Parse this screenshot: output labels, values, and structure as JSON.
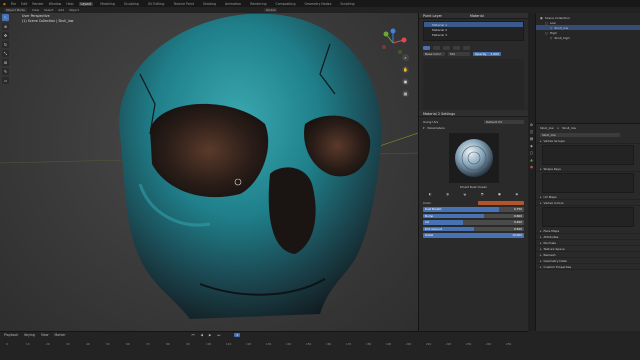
{
  "topbar": {
    "items": [
      "File",
      "Edit",
      "Render",
      "Window",
      "Help"
    ],
    "workspaces": [
      "Layout",
      "Modeling",
      "Sculpting",
      "UV Editing",
      "Texture Paint",
      "Shading",
      "Animation",
      "Rendering",
      "Compositing",
      "Geometry Nodes",
      "Scripting"
    ],
    "active_workspace": "Layout"
  },
  "toolstrip": {
    "mode": "Object Mode",
    "menus": [
      "View",
      "Select",
      "Add",
      "Object"
    ],
    "orientation": "Global"
  },
  "viewport": {
    "info_line1": "User Perspective",
    "info_line2": "(1) Scene Collection | Skull_low",
    "tools": [
      "cursor",
      "move",
      "rotate",
      "scale",
      "transform",
      "annotate",
      "measure"
    ]
  },
  "material_panel": {
    "header": "Point Layer",
    "header2": "Material",
    "slots": [
      "Material 1",
      "Material 2",
      "Material 3"
    ],
    "base_color_label": "Base Color",
    "blend_mode": "Mix",
    "opacity_label": "Opacity",
    "opacity_value": "1.000",
    "section_settings": "Material 2 Settings",
    "using_uvs_label": "Using UVs",
    "using_uvs_value": "Default UV",
    "parameters_label": "Parameters",
    "preset_name": "Smart Rust Ocean",
    "color_label": "Color",
    "params": [
      {
        "label": "Rust Breath",
        "value": "0.750",
        "fraction": 0.75
      },
      {
        "label": "Bump",
        "value": "0.600",
        "fraction": 0.6
      },
      {
        "label": "AO",
        "value": "0.400",
        "fraction": 0.4
      },
      {
        "label": "Dirt amount",
        "value": "0.500",
        "fraction": 0.5
      },
      {
        "label": "Detail",
        "value": "10.000",
        "fraction": 1.0
      }
    ],
    "color_swatch": "#b4542a"
  },
  "outliner": {
    "items": [
      {
        "label": "Scene Collection",
        "indent": 0,
        "selected": false
      },
      {
        "label": "Low",
        "indent": 1,
        "selected": false
      },
      {
        "label": "Skull_low",
        "indent": 2,
        "selected": true
      },
      {
        "label": "High",
        "indent": 1,
        "selected": false
      },
      {
        "label": "Skull_high",
        "indent": 2,
        "selected": false
      }
    ]
  },
  "properties": {
    "object_name": "Skull_low",
    "breadcrumb_sep": ">",
    "mesh_name": "Skull_low",
    "sections": [
      "Vertex Groups",
      "Shape Keys",
      "UV Maps",
      "Vertex Colors",
      "Face Maps",
      "Attributes",
      "Normals",
      "Texture Space",
      "Remesh",
      "Geometry Data",
      "Custom Properties"
    ]
  },
  "timeline": {
    "menus": [
      "Playback",
      "Keying",
      "View",
      "Marker"
    ],
    "frame": "1",
    "ticks": [
      "0",
      "10",
      "20",
      "30",
      "40",
      "50",
      "60",
      "70",
      "80",
      "90",
      "100",
      "110",
      "120",
      "130",
      "140",
      "150",
      "160",
      "170",
      "180",
      "190",
      "200",
      "210",
      "220",
      "230",
      "240",
      "250"
    ]
  },
  "colors": {
    "accent": "#4772b3",
    "skull_teal": "#2a8a96",
    "skull_dark": "#1f2a2e"
  }
}
